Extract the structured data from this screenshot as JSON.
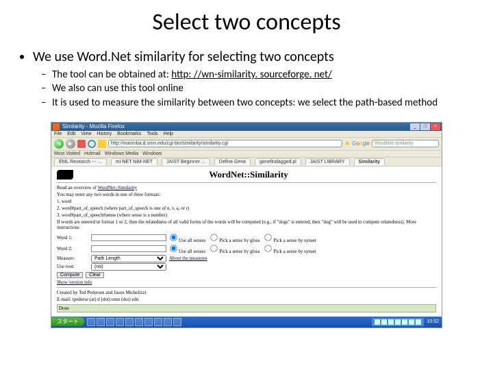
{
  "slide": {
    "title": "Select two concepts",
    "bullet": "We use Word.Net similarity for selecting two concepts",
    "sub": [
      {
        "prefix": "The tool can be obtained at: ",
        "link": "http: //wn-similarity. sourceforge. net/"
      },
      {
        "text": "We also can use this tool online"
      },
      {
        "text": "It is used to measure the similarity between two concepts: we select the path-based method"
      }
    ]
  },
  "browser": {
    "window_title": "Similarity - Mozilla Firefox",
    "menus": [
      "File",
      "Edit",
      "View",
      "History",
      "Bookmarks",
      "Tools",
      "Help"
    ],
    "url": "http://marimba.d.umn.edu/cgi-bin/similarity/similarity.cgi",
    "search_placeholder": "WordNet similarity",
    "bookmarks": [
      "Most Visited",
      "Hotmail",
      "Windows Media",
      "Windows"
    ],
    "tabs": [
      "EML Research --- ...",
      "mi-NET NiM-NET",
      "JAIST Beginner ...",
      "Define Gene",
      "genefindagged.pl",
      "JAIST LIBRARY",
      "Similarity"
    ]
  },
  "wn": {
    "heading": "WordNet::Similarity",
    "overview_prefix": "Read an overview of ",
    "overview_link": "WordNet::Similarity",
    "intro": "You may enter any two words in one of three formats:",
    "fmt1": "1. word",
    "fmt2_a": "2. word#part_of_speech (where part_of_speech is one of n, v, a, or r)",
    "fmt2_b": "3. word#part_of_speech#sense (where sense is a number)",
    "note": "If words are entered in format 1 or 2, then the relatedness of all valid forms of the words will be computed (e.g., if \"dogs\" is entered, then \"dog\" will be used to compute relatedness). More instructions",
    "labels": {
      "w1": "Word 1:",
      "w2": "Word 2:",
      "measure": "Measure:",
      "root": "Use root: "
    },
    "radios": {
      "all": "Use all senses",
      "gloss": "Pick a sense by gloss",
      "synset": "Pick a sense by synset",
      "about": "About the measures"
    },
    "measure_selected": "Path Length",
    "root_options": [
      "(no)"
    ],
    "buttons": {
      "compute": "Compute",
      "clear": "Clear"
    },
    "show_version": "Show version info",
    "credits": "Created by Ted Pedersen and Jason Michelizzi",
    "email": "E-mail: tpederse (at) d (dot) umn (dot) edu"
  },
  "taskbar": {
    "start": "スタート",
    "clock": "10:52"
  }
}
